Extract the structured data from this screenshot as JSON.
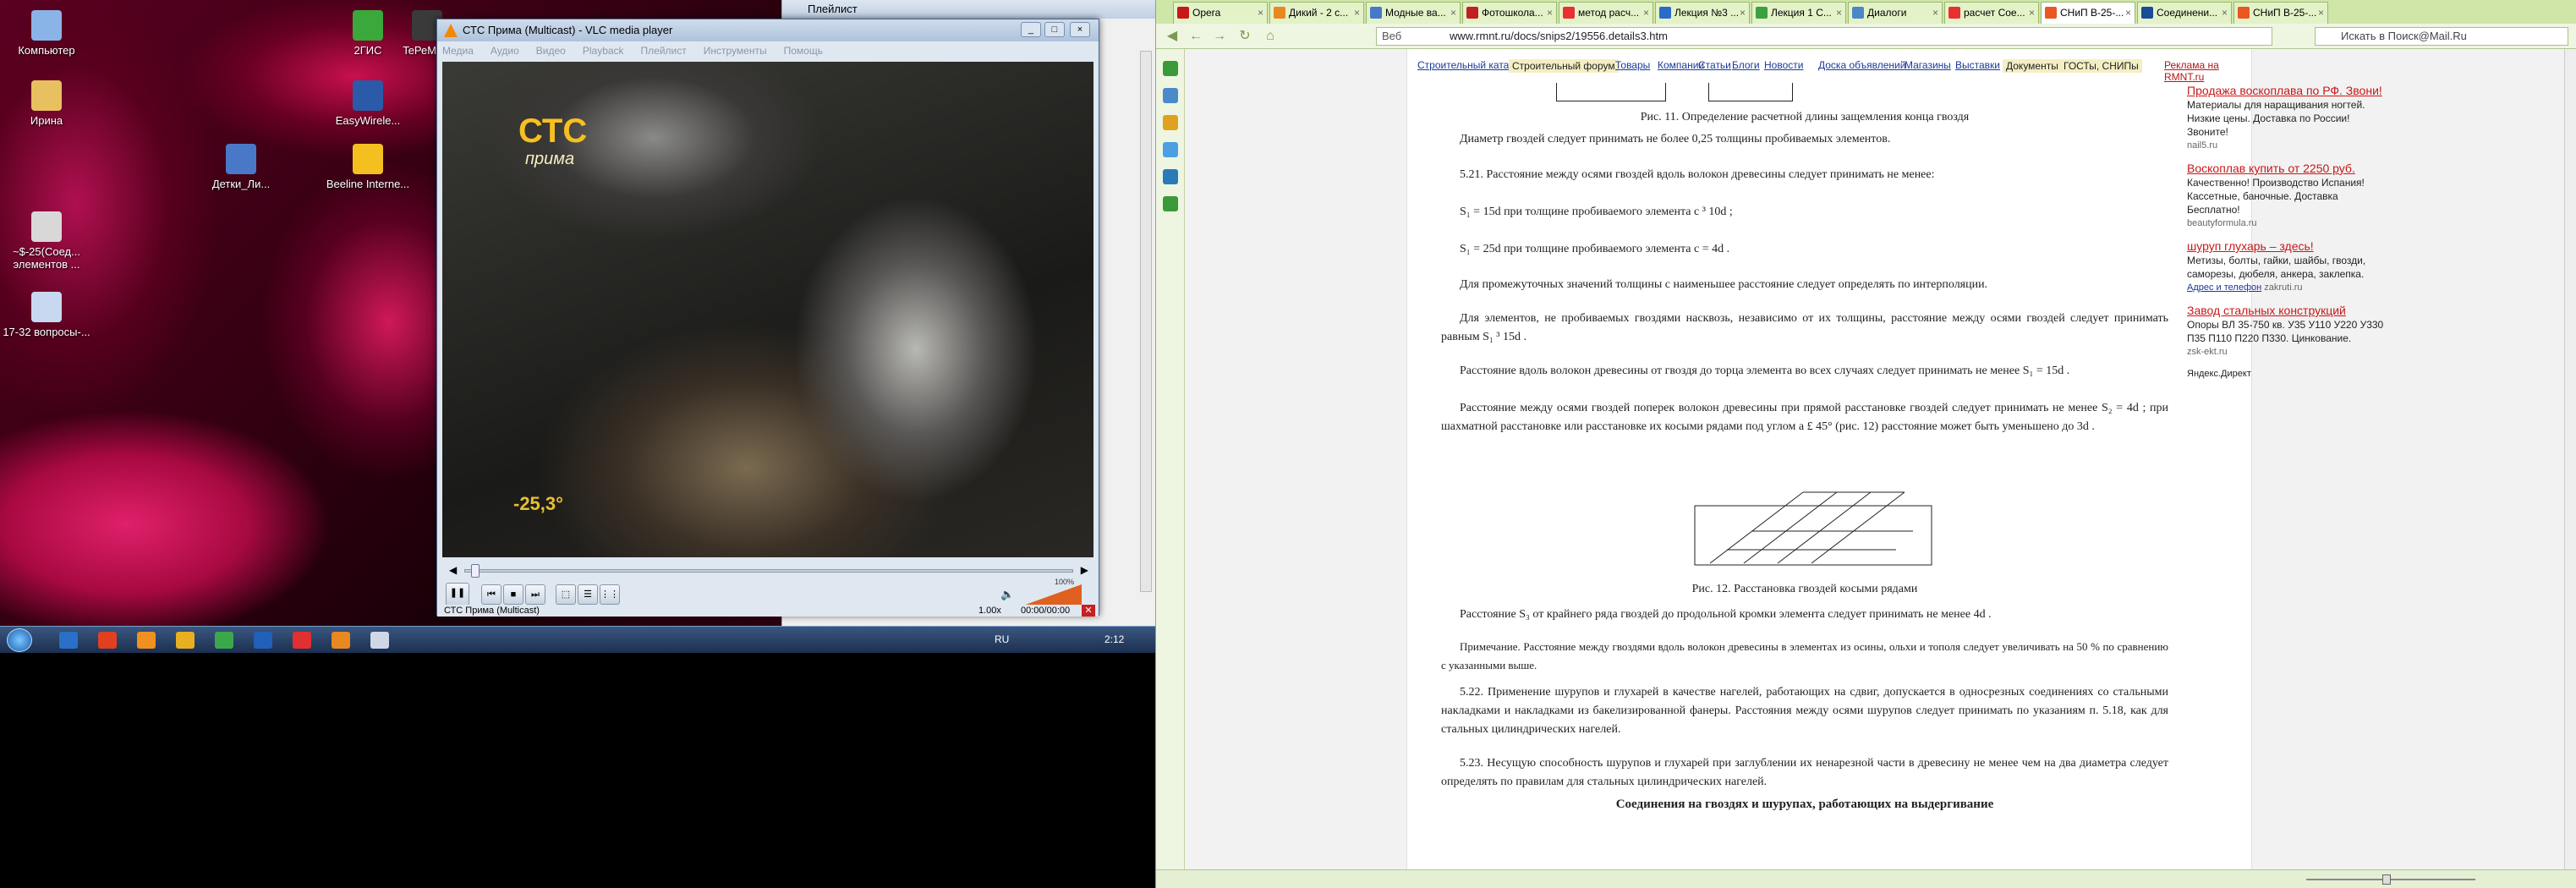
{
  "desktop": {
    "icons": [
      {
        "label": "Компьютер",
        "color": "#8ab4e8"
      },
      {
        "label": "Ирина",
        "color": "#e8c060"
      },
      {
        "label": "~$-25(Соед... элементов ...",
        "color": "#d8d8d8"
      },
      {
        "label": "17-32 вопросы-...",
        "color": "#c8d8f0"
      },
      {
        "label": "Детки_Ли...",
        "color": "#4a78c8"
      },
      {
        "label": "2ГИС",
        "color": "#3aa83a"
      },
      {
        "label": "EasyWirele...",
        "color": "#2a5aa8"
      },
      {
        "label": "Beeline Interne...",
        "color": "#f4c020"
      },
      {
        "label": "TeРеМОК",
        "color": "#3a3a3a"
      }
    ]
  },
  "taskbar": {
    "lang": "RU",
    "time": "2:12",
    "buttons": [
      "#2a70c8",
      "#e04020",
      "#f09020",
      "#e8b020",
      "#3aa84a",
      "#2060b8",
      "#e03030",
      "#e88820",
      "#d0d8e8"
    ]
  },
  "vlc": {
    "title": "СТС Прима (Multicast) - VLC media player",
    "menu": [
      "Медиа",
      "Аудио",
      "Видео",
      "Playback",
      "Плейлист",
      "Инструменты",
      "Помощь"
    ],
    "channel_logo": "СТС",
    "channel_sub": "прима",
    "temperature": "-25,3°",
    "volume": "100%",
    "status_name": "СТС Прима (Multicast)",
    "speed": "1.00x",
    "time": "00:00/00:00",
    "controls": [
      "pause",
      "prev",
      "stop",
      "next",
      "fullscreen",
      "playlist",
      "extended"
    ]
  },
  "playlist": {
    "title": "Плейлист"
  },
  "browser": {
    "tabs": [
      {
        "label": "Opera",
        "icon": "#c81818"
      },
      {
        "label": "Дикий - 2 с...",
        "icon": "#e88820"
      },
      {
        "label": "Модные ва...",
        "icon": "#4878c8"
      },
      {
        "label": "Фотошкола...",
        "icon": "#c02020"
      },
      {
        "label": "метод расч...",
        "icon": "#e83030"
      },
      {
        "label": "Лекция №3 ...",
        "icon": "#2a6ac8"
      },
      {
        "label": "Лекция 1 С...",
        "icon": "#3aa040"
      },
      {
        "label": "Диалоги",
        "icon": "#4a88c8"
      },
      {
        "label": "расчет Сое...",
        "icon": "#e83030"
      },
      {
        "label": "СНиП В-25-...",
        "icon": "#e85820"
      },
      {
        "label": "Соединени...",
        "icon": "#1a4a98"
      },
      {
        "label": "СНиП В-25-...",
        "icon": "#e85820"
      }
    ],
    "active_tab": 9,
    "url_prefix": "Веб",
    "url": "www.rmnt.ru/docs/snips2/19556.details3.htm",
    "search_placeholder": "Искать в Поиск@Mail.Ru"
  },
  "sitenav": {
    "items": [
      "Строительный каталог",
      "Строительный форум",
      "Товары",
      "Компании",
      "Статьи",
      "Блоги",
      "Новости",
      "Доска объявлений",
      "Магазины",
      "Выставки",
      "Документы",
      "ГОСТы, СНИПы"
    ],
    "ad": "Реклама на RMNT.ru"
  },
  "article": {
    "fig11_caption": "Рис. 11. Определение расчетной длины защемления конца гвоздя",
    "p1": "Диаметр гвоздей следует принимать не более 0,25 толщины пробиваемых элементов.",
    "p2": "5.21. Расстояние между осями гвоздей вдоль волокон древесины следует принимать не менее:",
    "f1": "S₁ = 15d при толщине пробиваемого элемента c ³ 10d ;",
    "f2": "S₁ = 25d при толщине пробиваемого элемента c = 4d .",
    "p3": "Для промежуточных значений толщины с наименьшее расстояние следует определять по интерполяции.",
    "p4": "Для элементов, не пробиваемых гвоздями насквозь, независимо от их толщины, расстояние между осями гвоздей следует принимать равным S₁ ³ 15d .",
    "p5": "Расстояние вдоль волокон древесины от гвоздя до торца элемента во всех случаях следует принимать не менее S₁ = 15d .",
    "p6": "Расстояние между осями гвоздей поперек волокон древесины при прямой расстановке гвоздей следует принимать не менее S₂ = 4d ; при шахматной расстановке или расстановке их косыми рядами под углом a £ 45° (рис. 12) расстояние может быть уменьшено до 3d .",
    "fig12_caption": "Рис. 12. Расстановка гвоздей косыми рядами",
    "p7": "Расстояние S₃ от крайнего ряда гвоздей до продольной кромки элемента следует принимать не менее 4d .",
    "p8": "Примечание. Расстояние между гвоздями вдоль волокон древесины в элементах из осины, ольхи и тополя следует увеличивать на 50 % по сравнению с указанными выше.",
    "p9": "5.22. Применение шурупов и глухарей в качестве нагелей, работающих на сдвиг, допускается в односрезных соединениях со стальными накладками и накладками из бакелизированной фанеры. Расстояния между осями шурупов следует принимать по указаниям п. 5.18, как для стальных цилиндрических нагелей.",
    "p10": "5.23. Несущую способность шурупов и глухарей при заглублении их ненарезной части в древесину не менее чем на два диаметра следует определять по правилам для стальных цилиндрических нагелей.",
    "heading": "Соединения на гвоздях и шурупах, работающих на выдергивание"
  },
  "ads": [
    {
      "title": "Продажа воскоплава по РФ. Звони!",
      "text": "Материалы для наращивания ногтей. Низкие цены. Доставка по России! Звоните!",
      "src": "nail5.ru"
    },
    {
      "title": "Воскоплав купить от 2250 руб.",
      "text": "Качественно! Производство Испания! Кассетные, баночные. Доставка Бесплатно!",
      "src": "beautyformula.ru"
    },
    {
      "title": "шуруп глухарь – здесь!",
      "text": "Метизы, болты, гайки, шайбы, гвозди, саморезы, дюбеля, анкера, заклепка.",
      "src": "zakruti.ru",
      "src_link": "Адрес и телефон"
    },
    {
      "title": "Завод стальных конструкций",
      "text": "Опоры ВЛ 35-750 кв. У35 У110 У220 У330 П35 П110 П220 П330. Цинкование.",
      "src": "zsk-ekt.ru"
    }
  ],
  "ads_footer": "Яндекс.Директ"
}
